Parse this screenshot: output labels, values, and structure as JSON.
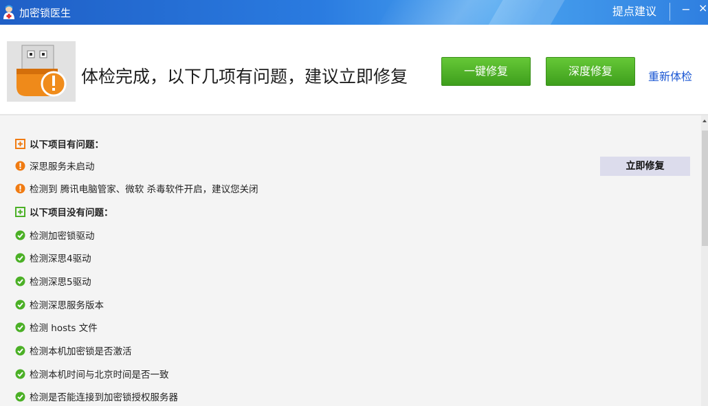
{
  "window": {
    "title": "加密锁医生",
    "feedback": "提点建议",
    "minimize": "−",
    "close": "×"
  },
  "header": {
    "headline": "体检完成，以下几项有问题，建议立即修复",
    "one_key_fix": "一键修复",
    "deep_fix": "深度修复",
    "recheck": "重新体检"
  },
  "problems": {
    "title": "以下项目有问题：",
    "items": [
      "深思服务未启动",
      "检测到 腾讯电脑管家、微软 杀毒软件开启，建议您关闭"
    ],
    "fix_now": "立即修复"
  },
  "ok": {
    "title": "以下项目没有问题：",
    "items": [
      "检测加密锁驱动",
      "检测深思4驱动",
      "检测深思5驱动",
      "检测深思服务版本",
      "检测 hosts 文件",
      "检测本机加密锁是否激活",
      "检测本机时间与北京时间是否一致",
      "检测是否能连接到加密锁授权服务器"
    ]
  },
  "colors": {
    "accent_green": "#4bb026",
    "warning_orange": "#f07b12",
    "link_blue": "#1b57d3",
    "titlebar_blue": "#2a7be0"
  }
}
